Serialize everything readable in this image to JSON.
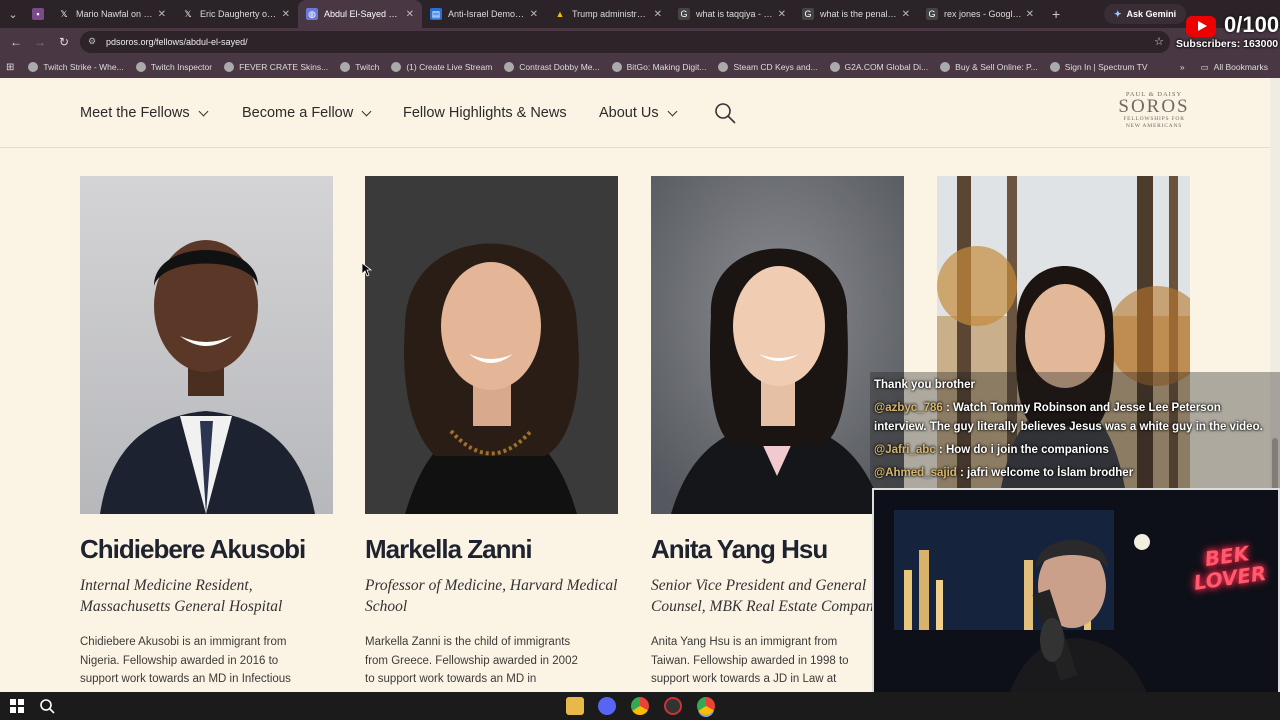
{
  "browser": {
    "tabs": [
      {
        "title": "Mario Nawfal on X: \"I",
        "icon": "x-logo-icon",
        "active": false
      },
      {
        "title": "Eric Daugherty on X: \"",
        "icon": "x-logo-icon",
        "active": false
      },
      {
        "title": "Abdul El-Sayed – Pau",
        "icon": "globe-icon",
        "active": true
      },
      {
        "title": "Anti-Israel Democrat",
        "icon": "news-icon",
        "active": false
      },
      {
        "title": "Trump administration",
        "icon": "drive-icon",
        "active": false
      },
      {
        "title": "what is taqqiya - Goo",
        "icon": "google-icon",
        "active": false
      },
      {
        "title": "what is the penalty fo",
        "icon": "google-icon",
        "active": false
      },
      {
        "title": "rex jones - Google Se",
        "icon": "google-icon",
        "active": false
      }
    ],
    "new_tab": "+",
    "gemini_label": "Ask Gemini",
    "url": "pdsoros.org/fellows/abdul-el-sayed/",
    "bookmarks": [
      "Twitch Strike - Whe...",
      "Twitch Inspector",
      "FEVER CRATE Skins...",
      "Twitch",
      "(1) Create Live Stream",
      "Contrast Dobby Me...",
      "BitGo: Making Digit...",
      "Steam CD Keys and...",
      "G2A.COM Global Di...",
      "Buy & Sell Online: P...",
      "Sign In | Spectrum TV"
    ],
    "all_bookmarks": "All Bookmarks"
  },
  "site": {
    "nav": [
      {
        "label": "Meet the Fellows",
        "has_dropdown": true
      },
      {
        "label": "Become a Fellow",
        "has_dropdown": true
      },
      {
        "label": "Fellow Highlights & News",
        "has_dropdown": false
      },
      {
        "label": "About Us",
        "has_dropdown": true
      }
    ],
    "logo": {
      "line1": "PAUL & DAISY",
      "line2": "SOROS",
      "line3": "FELLOWSHIPS FOR",
      "line4": "NEW AMERICANS"
    },
    "fellows": [
      {
        "name": "Chidiebere Akusobi",
        "role": "Internal Medicine Resident, Massachusetts General Hospital",
        "bio": "Chidiebere Akusobi is an immigrant from Nigeria. Fellowship awarded in 2016 to support work towards an MD in Infectious Disease and a PhD in"
      },
      {
        "name": "Markella Zanni",
        "role": "Professor of Medicine, Harvard Medical School",
        "bio": "Markella Zanni is the child of immigrants from Greece. Fellowship awarded in 2002 to support work towards an MD in Medicine at Harvard University"
      },
      {
        "name": "Anita Yang Hsu",
        "role": "Senior Vice President and General Counsel, MBK Real Estate Company",
        "bio": "Anita Yang Hsu is an immigrant from Taiwan. Fellowship awarded in 1998 to support work towards a JD in Law at University of California, Berkeley"
      }
    ]
  },
  "overlay": {
    "youtube_count": "0/100",
    "subscribers": "Subscribers: 163000",
    "chat": [
      {
        "user": "",
        "text": "Thank you brother"
      },
      {
        "user": "@azbyc_786",
        "text": " : Watch Tommy Robinson and Jesse Lee Peterson"
      },
      {
        "user": "",
        "text": "interview. The guy literally believes Jesus was a white guy in the video."
      },
      {
        "user": "@Jafri_abc",
        "text": " : How do i join the companions"
      },
      {
        "user": "@Ahmed_sajid",
        "text": " : jafri welcome to İslam brodher"
      }
    ],
    "neon_line1": "BEK",
    "neon_line2": "LOVER"
  },
  "colors": {
    "page_bg": "#fbf4e4",
    "tab_active": "#4a3744",
    "neon": "#ff2a4a",
    "chat_user": "#d9b56a"
  }
}
